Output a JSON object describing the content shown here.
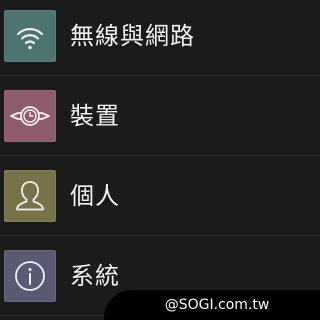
{
  "settings": {
    "items": [
      {
        "label": "無線與網路",
        "icon": "wifi-icon",
        "tile_color": "#4e7472"
      },
      {
        "label": "裝置",
        "icon": "device-watch-icon",
        "tile_color": "#8e5c6c"
      },
      {
        "label": "個人",
        "icon": "person-icon",
        "tile_color": "#77724a"
      },
      {
        "label": "系統",
        "icon": "info-icon",
        "tile_color": "#5b5a74"
      }
    ]
  },
  "watermark": {
    "text": "@SOGI.com.tw"
  },
  "colors": {
    "background": "#1b1b1b",
    "divider": "#2e2e2e",
    "label_text": "#f2f2f2"
  }
}
